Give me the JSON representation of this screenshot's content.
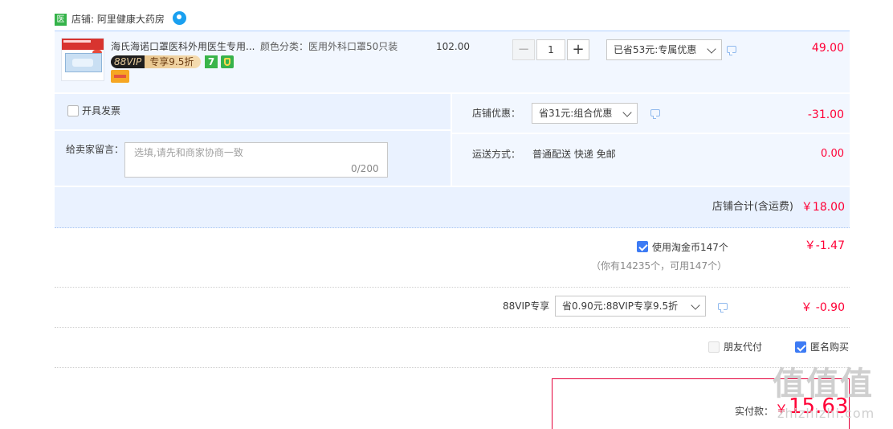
{
  "shop": {
    "badge": "医",
    "label": "店铺: 阿里健康大药房",
    "wangwang_icon": "wangwang-chat-icon"
  },
  "product": {
    "title": "海氏海诺口罩医科外用医生专用...",
    "vip_left": "88VIP",
    "vip_right": "专享9.5折",
    "tag_seven": "7",
    "sku": "颜色分类：医用外科口罩50只装",
    "price": "102.00",
    "qty_minus": "−",
    "qty_value": "1",
    "qty_plus": "+",
    "promo_select": "已省53元:专属优惠",
    "amount": "49.00"
  },
  "invoice": {
    "label": "开具发票",
    "checked": false
  },
  "memo": {
    "label": "给卖家留言：",
    "placeholder": "选填,请先和商家协商一致",
    "count": "0/200"
  },
  "shop_discount": {
    "label": "店铺优惠：",
    "select": "省31元:组合优惠",
    "amount": "-31.00"
  },
  "shipping": {
    "label": "运送方式：",
    "value": "普通配送 快递 免邮",
    "amount": "0.00"
  },
  "shop_total": {
    "label": "店铺合计(含运费)",
    "amount": "￥18.00"
  },
  "taojinbi": {
    "label": "使用淘金币147个",
    "sub": "（你有14235个，可用147个）",
    "amount": "￥-1.47",
    "checked": true
  },
  "vip88": {
    "label": "88VIP专享",
    "select": "省0.90元:88VIP专享9.5折",
    "amount": "￥ -0.90"
  },
  "friend_pay": {
    "label": "朋友代付",
    "checked": false
  },
  "anonymous": {
    "label": "匿名购买",
    "checked": true
  },
  "payment": {
    "label": "实付款：",
    "currency": "￥",
    "amount": "15.63"
  },
  "watermark": {
    "main": "值值值",
    "sub": "zhizhizhi.com"
  },
  "colors": {
    "price_red": "#ff0036",
    "accent_blue": "#3d7bf4",
    "row_bg": "#f2f7ff"
  }
}
